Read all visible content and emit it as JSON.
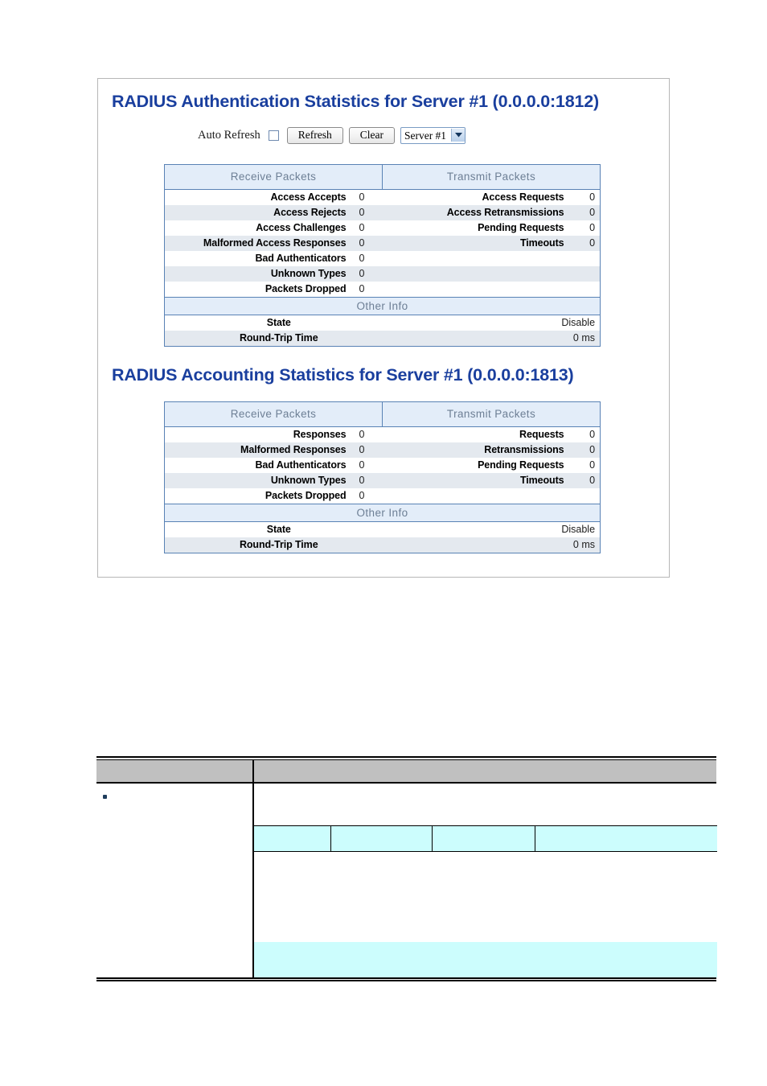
{
  "screenshot": {
    "auth_section": {
      "heading": "RADIUS Authentication Statistics for Server #1 (0.0.0.0:1812)",
      "controls": {
        "auto_refresh_label": "Auto Refresh",
        "auto_refresh_checked": false,
        "refresh_label": "Refresh",
        "clear_label": "Clear",
        "server_select_value": "Server #1"
      },
      "table": {
        "receive_header": "Receive Packets",
        "transmit_header": "Transmit Packets",
        "other_info_header": "Other Info",
        "rows": [
          {
            "rx_name": "Access Accepts",
            "rx_value": "0",
            "tx_name": "Access Requests",
            "tx_value": "0"
          },
          {
            "rx_name": "Access Rejects",
            "rx_value": "0",
            "tx_name": "Access Retransmissions",
            "tx_value": "0"
          },
          {
            "rx_name": "Access Challenges",
            "rx_value": "0",
            "tx_name": "Pending Requests",
            "tx_value": "0"
          },
          {
            "rx_name": "Malformed Access Responses",
            "rx_value": "0",
            "tx_name": "Timeouts",
            "tx_value": "0"
          },
          {
            "rx_name": "Bad Authenticators",
            "rx_value": "0",
            "tx_name": "",
            "tx_value": ""
          },
          {
            "rx_name": "Unknown Types",
            "rx_value": "0",
            "tx_name": "",
            "tx_value": ""
          },
          {
            "rx_name": "Packets Dropped",
            "rx_value": "0",
            "tx_name": "",
            "tx_value": ""
          }
        ],
        "other_info": [
          {
            "label": "State",
            "value": "Disable"
          },
          {
            "label": "Round-Trip Time",
            "value": "0 ms"
          }
        ]
      }
    },
    "acct_section": {
      "heading": "RADIUS Accounting Statistics for Server #1 (0.0.0.0:1813)",
      "table": {
        "receive_header": "Receive Packets",
        "transmit_header": "Transmit Packets",
        "other_info_header": "Other Info",
        "rows": [
          {
            "rx_name": "Responses",
            "rx_value": "0",
            "tx_name": "Requests",
            "tx_value": "0"
          },
          {
            "rx_name": "Malformed Responses",
            "rx_value": "0",
            "tx_name": "Retransmissions",
            "tx_value": "0"
          },
          {
            "rx_name": "Bad Authenticators",
            "rx_value": "0",
            "tx_name": "Pending Requests",
            "tx_value": "0"
          },
          {
            "rx_name": "Unknown Types",
            "rx_value": "0",
            "tx_name": "Timeouts",
            "tx_value": "0"
          },
          {
            "rx_name": "Packets Dropped",
            "rx_value": "0",
            "tx_name": "",
            "tx_value": ""
          }
        ],
        "other_info": [
          {
            "label": "State",
            "value": "Disable"
          },
          {
            "label": "Round-Trip Time",
            "value": "0 ms"
          }
        ]
      }
    }
  },
  "doc_table": {
    "header_left": "",
    "header_right": "",
    "bullet_text": "",
    "inner_row_cells": [
      "",
      "",
      "",
      ""
    ],
    "inner_block_text": ""
  },
  "colors": {
    "heading_blue": "#1a3f9e",
    "table_border_blue": "#5982b5",
    "group_header_bg": "#e3edf9",
    "group_header_text": "#6d7f95",
    "row_alt_bg": "#e4e9ef",
    "doc_header_gray": "#c0c0c0",
    "doc_cyan": "#ccfdfd",
    "frame_border": "#b7b7b7"
  }
}
